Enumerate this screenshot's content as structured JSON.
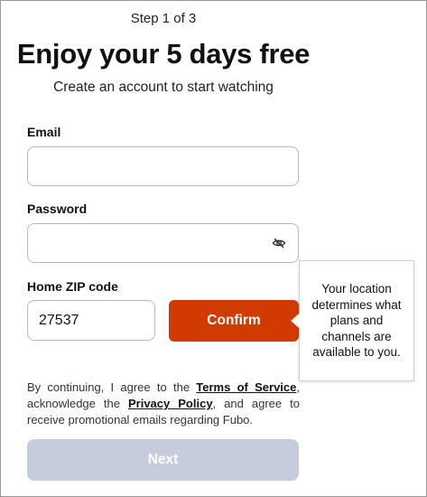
{
  "header": {
    "step": "Step 1 of 3",
    "title": "Enjoy your 5 days free",
    "subtitle": "Create an account to start watching"
  },
  "form": {
    "email_label": "Email",
    "email_value": "",
    "password_label": "Password",
    "password_value": "",
    "password_toggle_icon": "eye-slash-icon",
    "zip_label": "Home ZIP code",
    "zip_value": "27537",
    "confirm_label": "Confirm"
  },
  "tooltip": {
    "text": "Your location determines what plans and channels are available to you."
  },
  "legal": {
    "prefix": "By continuing, I agree to the ",
    "terms_link": "Terms of Service",
    "middle": ", acknowledge the ",
    "privacy_link": "Privacy Policy",
    "suffix": ", and agree to receive promotional emails regarding Fubo."
  },
  "next_label": "Next",
  "colors": {
    "confirm_bg": "#d13a00",
    "next_disabled_bg": "#c7ccdc"
  }
}
